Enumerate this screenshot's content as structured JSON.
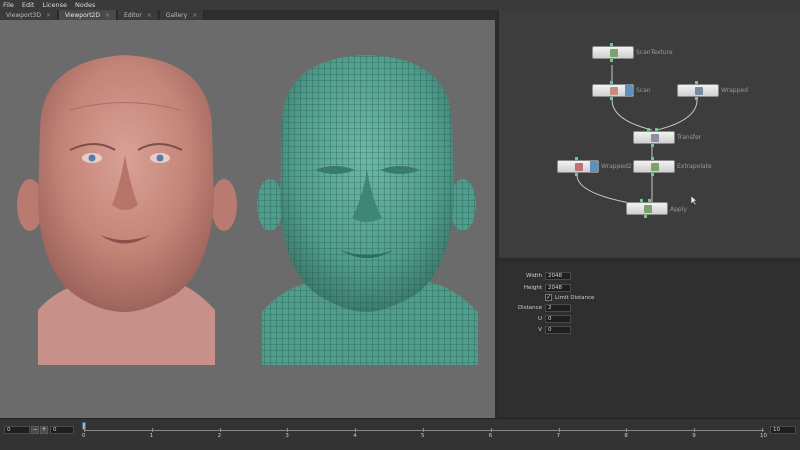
{
  "menu": [
    "File",
    "Edit",
    "License",
    "Nodes"
  ],
  "tabs": [
    {
      "label": "Viewport3D",
      "active": false
    },
    {
      "label": "Viewport2D",
      "active": true
    },
    {
      "label": "Editor",
      "active": false
    },
    {
      "label": "Gallery",
      "active": false
    }
  ],
  "nodes": [
    {
      "label": "ScanTexture",
      "thumb_color": "#7aa36a",
      "accent": false
    },
    {
      "label": "Scan",
      "thumb_color": "#c98a80",
      "accent": true
    },
    {
      "label": "Wrapped",
      "thumb_color": "#7c8aa0",
      "accent": false
    },
    {
      "label": "Transfer",
      "thumb_color": "#8e8ea2",
      "accent": false
    },
    {
      "label": "Wrapped2",
      "thumb_color": "#c07070",
      "accent": true
    },
    {
      "label": "Extrapolate",
      "thumb_color": "#7aa36a",
      "accent": false
    },
    {
      "label": "Apply",
      "thumb_color": "#7aa36a",
      "accent": false
    }
  ],
  "properties": {
    "width_label": "Width",
    "width_value": "2048",
    "height_label": "Height",
    "height_value": "2048",
    "limit_label": "Limit Distance",
    "limit_checked": true,
    "distance_label": "Distance",
    "distance_value": "2",
    "u_label": "U",
    "u_value": "0",
    "v_label": "V",
    "v_value": "0"
  },
  "timeline": {
    "start": "0",
    "current": "0",
    "end": "10",
    "ticks": [
      "0",
      "1",
      "2",
      "3",
      "4",
      "5",
      "6",
      "7",
      "8",
      "9",
      "10"
    ],
    "minus": "−",
    "plus": "+"
  },
  "colors": {
    "viewport_bg": "#6b6b6b",
    "mesh": "#4f9e8d",
    "skin": "#c98d86",
    "port": "#5fcf8f"
  }
}
